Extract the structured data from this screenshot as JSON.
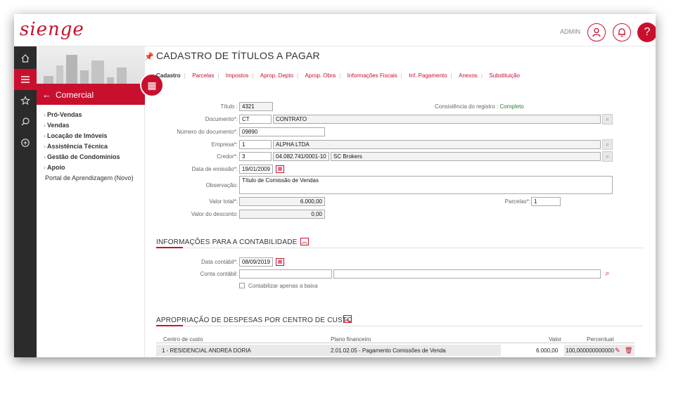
{
  "header": {
    "logo": "sienge",
    "user": "ADMIN",
    "help": "?"
  },
  "sidepanel": {
    "module": "Comercial",
    "items": [
      {
        "label": "Pró-Vendas"
      },
      {
        "label": "Vendas"
      },
      {
        "label": "Locação de Imóveis"
      },
      {
        "label": "Assistência Técnica"
      },
      {
        "label": "Gestão de Condomínios"
      },
      {
        "label": "Apoio"
      }
    ],
    "portal": "Portal de Aprendizagem (Novo)"
  },
  "page": {
    "title": "CADASTRO DE TÍTULOS A PAGAR",
    "tabs": [
      "Cadastro",
      "Parcelas",
      "Impostos",
      "Aprop. Depto",
      "Aprop. Obra",
      "Informações Fiscais",
      "Inf. Pagamento",
      "Anexos",
      "Substituição"
    ]
  },
  "form": {
    "titulo_label": "Título :",
    "titulo_value": "4321",
    "consistencia_label": "Consistência do registro :",
    "consistencia_value": "Completo",
    "documento_label": "Documento*:",
    "documento_code": "CT",
    "documento_desc": "CONTRATO",
    "numero_doc_label": "Número do documento*:",
    "numero_doc_value": "09890",
    "empresa_label": "Empresa*:",
    "empresa_code": "1",
    "empresa_name": "ALPHA LTDA",
    "credor_label": "Credor*:",
    "credor_code": "3",
    "credor_cnpj": "04.082.741/0001-10",
    "credor_name": "SC Brokers",
    "data_emissao_label": "Data de emissão*:",
    "data_emissao_value": "19/01/2009",
    "observacao_label": "Observação:",
    "observacao_value": "Título de Comissão de Vendas",
    "valor_total_label": "Valor total*:",
    "valor_total_value": "6.000,00",
    "parcelas_label": "Parcelas*:",
    "parcelas_value": "1",
    "valor_desconto_label": "Valor do desconto:",
    "valor_desconto_value": "0,00"
  },
  "contabilidade": {
    "title": "INFORMAÇÕES PARA A CONTABILIDADE",
    "data_contabil_label": "Data contábil*:",
    "data_contabil_value": "08/09/2019",
    "conta_contabil_label": "Conta contábil:",
    "conta_contabil_value": "",
    "checkbox_label": "Contabilizar apenas a baixa"
  },
  "apropriacao": {
    "title": "APROPRIAÇÃO DE DESPESAS POR CENTRO DE CUSTO",
    "columns": [
      "Centro de custo",
      "Plano financeiro",
      "Valor",
      "Percentual"
    ],
    "rows": [
      {
        "centro": "1 - RESIDENCIAL ANDREA DORIA",
        "plano": "2.01.02.05 - Pagamento Comissões de Venda",
        "valor": "6.000,00",
        "percentual": "100,000000000000"
      }
    ]
  }
}
